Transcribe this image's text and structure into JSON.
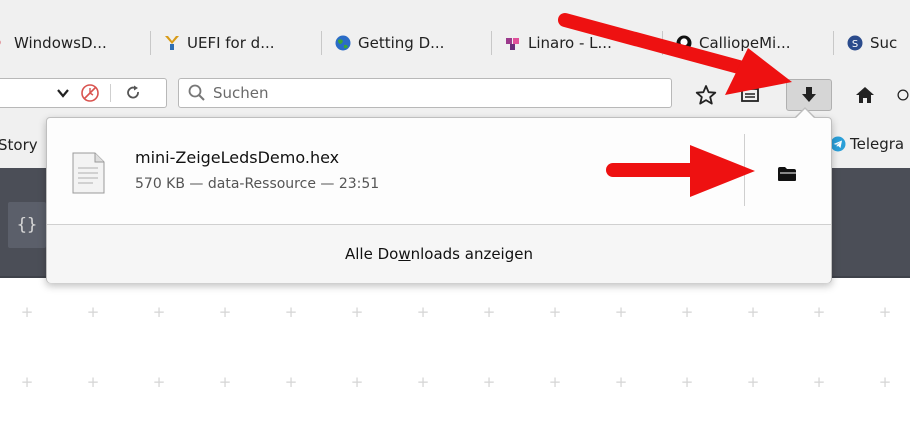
{
  "bookmarks": [
    {
      "label": "WindowsD...",
      "icon": "red-heart-icon"
    },
    {
      "label": "UEFI for d...",
      "icon": "uefi-icon"
    },
    {
      "label": "Getting D...",
      "icon": "globe-icon"
    },
    {
      "label": "Linaro - L...",
      "icon": "linaro-icon"
    },
    {
      "label": "CalliopeMi...",
      "icon": "github-icon"
    },
    {
      "label": "Suc",
      "icon": "suc-icon"
    }
  ],
  "search": {
    "placeholder": "Suchen"
  },
  "row2": {
    "left_label": "Story",
    "right_label": "Telegra"
  },
  "editor": {
    "braces": "{}"
  },
  "download": {
    "filename": "mini-ZeigeLedsDemo.hex",
    "meta": "570 KB — data-Ressource — 23:51",
    "footer_pre": "Alle Do",
    "footer_accel": "w",
    "footer_post": "nloads anzeigen"
  },
  "colors": {
    "arrow": "#ee1111",
    "dark_panel": "#4b4e57",
    "toolbar": "#f0f0f0"
  }
}
